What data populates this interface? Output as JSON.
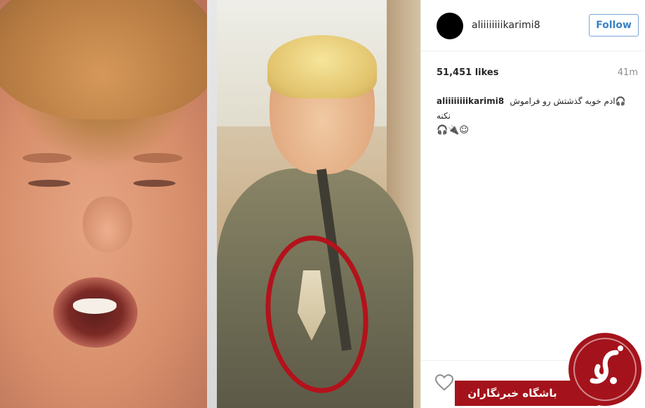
{
  "post": {
    "username": "aliiiiiiiikarimi8",
    "follow_label": "Follow",
    "likes": "51,451 likes",
    "time_ago": "41m",
    "caption_user": "aliiiiiiiikarimi8",
    "caption_text": "🎧ادم خوبه گذشتش رو فراموش نکنه",
    "caption_emoji": "🎧🔌☺"
  },
  "watermark": {
    "text": "باشگاه خبرنگاران",
    "logo_icon": "jj-logo-icon",
    "color": "#a4131b"
  },
  "colors": {
    "follow_border": "#7aa6d6",
    "follow_text": "#3b82c4",
    "circle_mark": "#b3121b"
  }
}
